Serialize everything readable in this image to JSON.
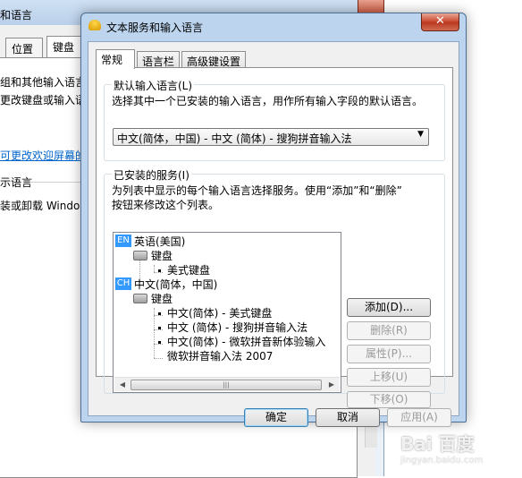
{
  "background_window": {
    "title": "和语言",
    "tabs": [
      "位置",
      "键盘"
    ],
    "lines": [
      "组和其他输入语言",
      "更改键盘或输入语",
      "示语言",
      "装或卸载 Windo"
    ],
    "link": "可更改欢迎屏幕的"
  },
  "dialog": {
    "title": "文本服务和输入语言",
    "close_glyph": "✕",
    "tabs": [
      "常规",
      "语言栏",
      "高级键设置"
    ],
    "default_group": {
      "label": "默认输入语言(L)",
      "description": "选择其中一个已安装的输入语言，用作所有输入字段的默认语言。",
      "selected": "中文(简体，中国) - 中文 (简体) - 搜狗拼音输入法",
      "arrow": "▼"
    },
    "services_group": {
      "label": "已安装的服务(I)",
      "description_line1": "为列表中显示的每个输入语言选择服务。使用“添加”和“删除”",
      "description_line2": "按钮来修改这个列表。",
      "tree": {
        "lang1_badge": "EN",
        "lang1": "英语(美国)",
        "lang1_cat": "键盘",
        "lang1_items": [
          "美式键盘"
        ],
        "lang2_badge": "CH",
        "lang2": "中文(简体，中国)",
        "lang2_cat": "键盘",
        "lang2_items": [
          "中文(简体) - 美式键盘",
          "中文 (简体) - 搜狗拼音输入法",
          "中文(简体) - 微软拼音新体验输入",
          "微软拼音输入法 2007"
        ]
      },
      "scroll_left": "◀",
      "scroll_right": "▶",
      "scroll_grip": "|||",
      "buttons": {
        "add": "添加(D)...",
        "remove": "删除(R)",
        "properties": "属性(P)...",
        "move_up": "上移(U)",
        "move_down": "下移(O)"
      }
    },
    "footer": {
      "ok": "确定",
      "cancel": "取消",
      "apply": "应用(A)"
    }
  },
  "watermark": {
    "brand": "Bai 百度",
    "sub": "jingyan.baidu.com"
  },
  "colors": {
    "accent_selected": "#3399ff",
    "close_button": "#c9462d",
    "title_bar": "#bcd4ee"
  }
}
